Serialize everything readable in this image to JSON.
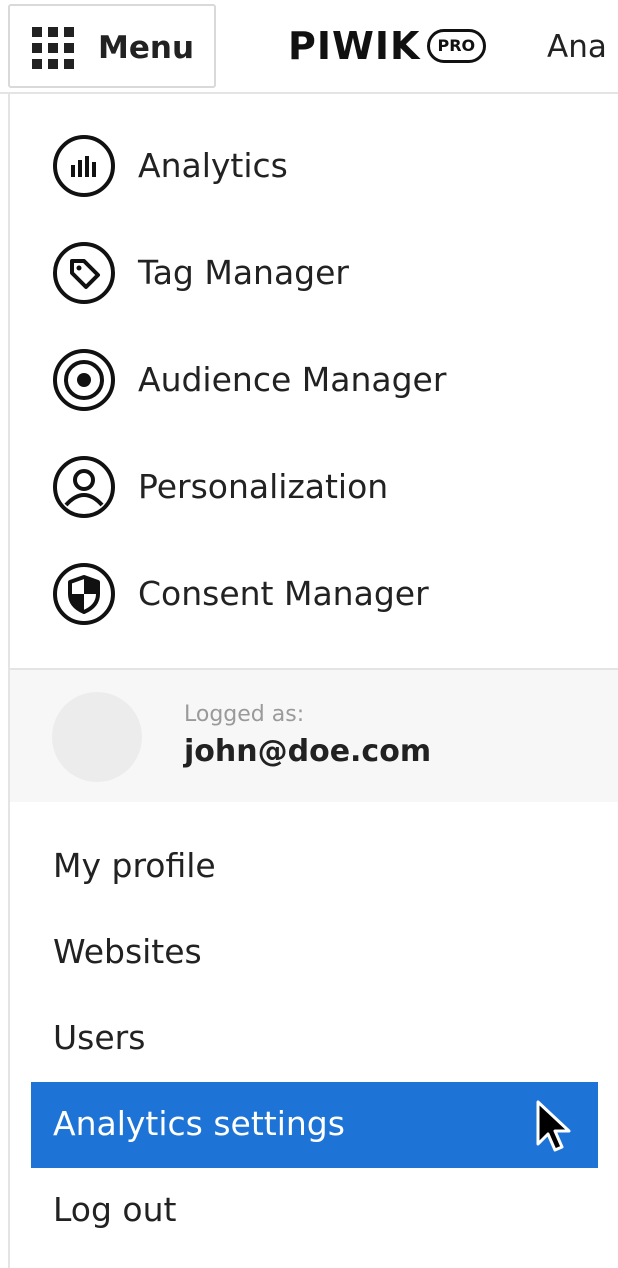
{
  "header": {
    "menu_label": "Menu",
    "logo_text": "PIWIK",
    "logo_badge": "PRO",
    "product_name": "Ana"
  },
  "apps": [
    {
      "label": "Analytics",
      "icon": "analytics-icon"
    },
    {
      "label": "Tag Manager",
      "icon": "tag-icon"
    },
    {
      "label": "Audience Manager",
      "icon": "target-icon"
    },
    {
      "label": "Personalization",
      "icon": "user-circle-icon"
    },
    {
      "label": "Consent Manager",
      "icon": "shield-icon"
    }
  ],
  "user": {
    "logged_as_label": "Logged as:",
    "email": "john@doe.com"
  },
  "links": [
    {
      "label": "My profile"
    },
    {
      "label": "Websites"
    },
    {
      "label": "Users"
    },
    {
      "label": "Analytics settings",
      "active": true
    },
    {
      "label": "Log out"
    }
  ],
  "colors": {
    "active_background": "#1e74d6",
    "active_text": "#ffffff",
    "text": "#222222",
    "muted_text": "#9a9a9a"
  }
}
